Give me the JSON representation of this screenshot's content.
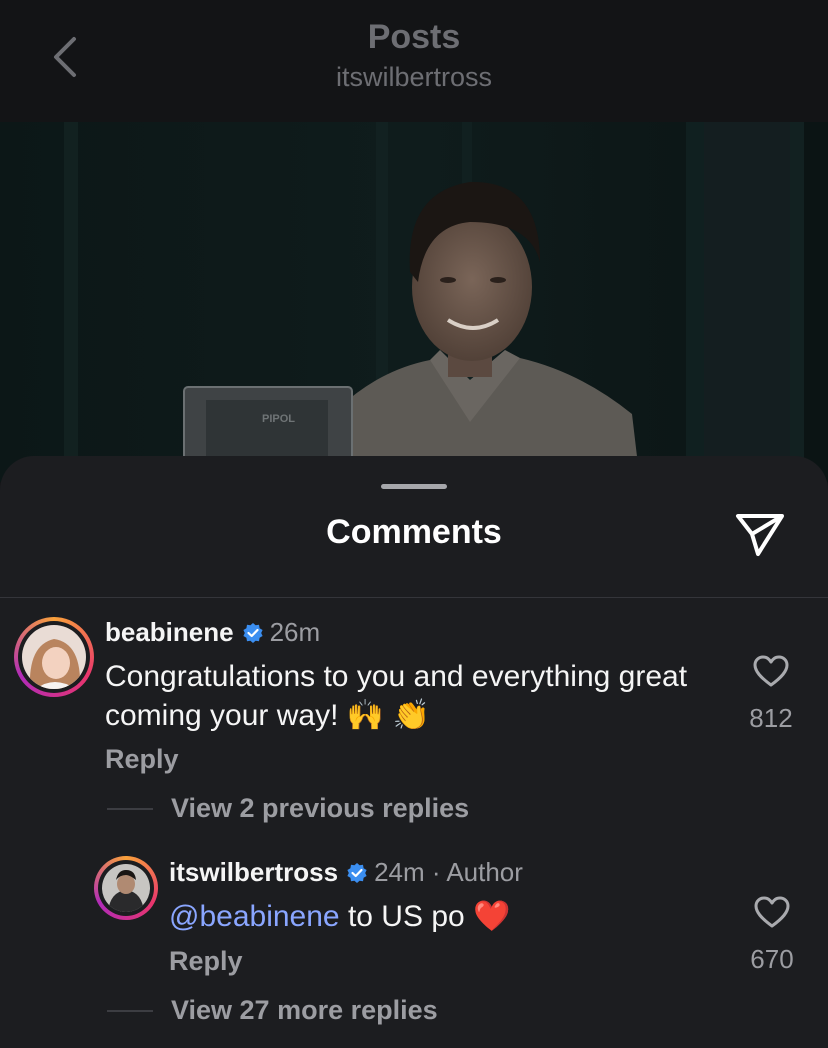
{
  "header": {
    "title": "Posts",
    "subtitle": "itswilbertross"
  },
  "post": {
    "plaque_text": "PIPOL"
  },
  "comments_sheet": {
    "title": "Comments"
  },
  "comments": [
    {
      "username": "beabinene",
      "time": "26m",
      "text": "Congratulations to you and everything great coming your way! 🙌 👏",
      "reply_label": "Reply",
      "likes": "812",
      "view_replies": "View 2 previous replies"
    },
    {
      "username": "itswilbertross",
      "time": "24m",
      "author_tag": "· Author",
      "mention": "@beabinene",
      "text": "to US po ❤️",
      "reply_label": "Reply",
      "likes": "670",
      "view_replies": "View 27 more replies"
    }
  ],
  "colors": {
    "background": "#131416",
    "sheet": "#1c1d20",
    "mention": "#8aa6ff",
    "verified": "#3b8ef0",
    "muted": "#9c9da2"
  },
  "icons": {
    "back": "chevron-left-icon",
    "share": "paper-plane-icon",
    "verified": "verified-badge-icon",
    "like": "heart-outline-icon"
  }
}
